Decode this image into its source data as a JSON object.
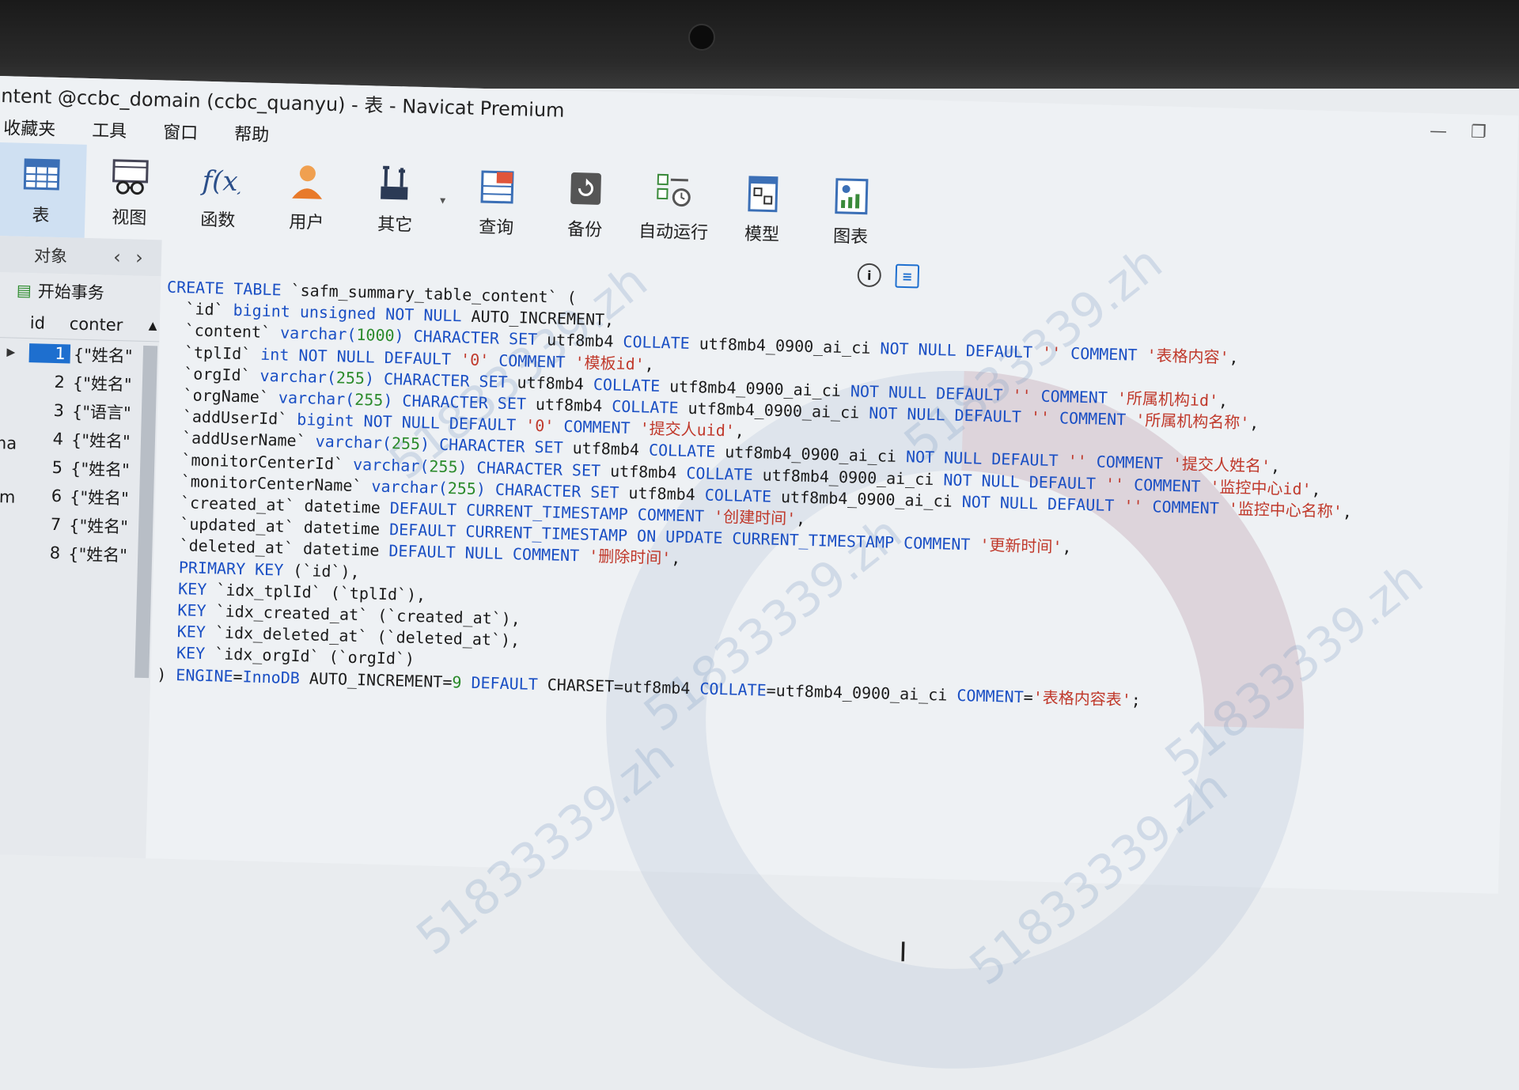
{
  "window": {
    "title": "ntent @ccbc_domain (ccbc_quanyu) - 表 - Navicat Premium"
  },
  "menu": [
    "收藏夹",
    "工具",
    "窗口",
    "帮助"
  ],
  "toolbar": [
    {
      "label": "表",
      "icon": "table-icon",
      "active": true
    },
    {
      "label": "视图",
      "icon": "view-icon"
    },
    {
      "label": "函数",
      "icon": "function-icon"
    },
    {
      "label": "用户",
      "icon": "user-icon"
    },
    {
      "label": "其它",
      "icon": "tools-icon"
    },
    {
      "label": "查询",
      "icon": "query-icon"
    },
    {
      "label": "备份",
      "icon": "backup-icon"
    },
    {
      "label": "自动运行",
      "icon": "schedule-icon"
    },
    {
      "label": "模型",
      "icon": "model-icon"
    },
    {
      "label": "图表",
      "icon": "chart-icon"
    }
  ],
  "objects": {
    "label": "对象",
    "begin_transaction": "开始事务"
  },
  "grid": {
    "columns": [
      "id",
      "conter"
    ],
    "rows": [
      {
        "id": "1",
        "value": "{\"姓名\""
      },
      {
        "id": "2",
        "value": "{\"姓名\""
      },
      {
        "id": "3",
        "value": "{\"语言\""
      },
      {
        "id": "4",
        "value": "{\"姓名\""
      },
      {
        "id": "5",
        "value": "{\"姓名\""
      },
      {
        "id": "6",
        "value": "{\"姓名\""
      },
      {
        "id": "7",
        "value": "{\"姓名\""
      },
      {
        "id": "8",
        "value": "{\"姓名\""
      }
    ],
    "side_labels": [
      "ma",
      "em"
    ]
  },
  "sql_lines": [
    [
      [
        "kw",
        "CREATE TABLE "
      ],
      [
        "t",
        "`safm_summary_table_content` ("
      ]
    ],
    [
      [
        "t",
        "  `id` "
      ],
      [
        "kw",
        "bigint unsigned NOT NULL "
      ],
      [
        "t",
        "AUTO_INCREMENT,"
      ]
    ],
    [
      [
        "t",
        "  `content` "
      ],
      [
        "kw",
        "varchar("
      ],
      [
        "num",
        "1000"
      ],
      [
        "kw",
        ") CHARACTER SET "
      ],
      [
        "t",
        "utf8mb4 "
      ],
      [
        "kw",
        "COLLATE "
      ],
      [
        "t",
        "utf8mb4_0900_ai_ci "
      ],
      [
        "kw",
        "NOT NULL DEFAULT "
      ],
      [
        "str",
        "'' "
      ],
      [
        "kw",
        "COMMENT "
      ],
      [
        "str",
        "'表格内容'"
      ],
      [
        "t",
        ","
      ]
    ],
    [
      [
        "t",
        "  `tplId` "
      ],
      [
        "kw",
        "int NOT NULL DEFAULT "
      ],
      [
        "str",
        "'0' "
      ],
      [
        "kw",
        "COMMENT "
      ],
      [
        "str",
        "'模板id'"
      ],
      [
        "t",
        ","
      ]
    ],
    [
      [
        "t",
        "  `orgId` "
      ],
      [
        "kw",
        "varchar("
      ],
      [
        "num",
        "255"
      ],
      [
        "kw",
        ") CHARACTER SET "
      ],
      [
        "t",
        "utf8mb4 "
      ],
      [
        "kw",
        "COLLATE "
      ],
      [
        "t",
        "utf8mb4_0900_ai_ci "
      ],
      [
        "kw",
        "NOT NULL DEFAULT "
      ],
      [
        "str",
        "'' "
      ],
      [
        "kw",
        "COMMENT "
      ],
      [
        "str",
        "'所属机构id'"
      ],
      [
        "t",
        ","
      ]
    ],
    [
      [
        "t",
        "  `orgName` "
      ],
      [
        "kw",
        "varchar("
      ],
      [
        "num",
        "255"
      ],
      [
        "kw",
        ") CHARACTER SET "
      ],
      [
        "t",
        "utf8mb4 "
      ],
      [
        "kw",
        "COLLATE "
      ],
      [
        "t",
        "utf8mb4_0900_ai_ci "
      ],
      [
        "kw",
        "NOT NULL DEFAULT "
      ],
      [
        "str",
        "'' "
      ],
      [
        "kw",
        "COMMENT "
      ],
      [
        "str",
        "'所属机构名称'"
      ],
      [
        "t",
        ","
      ]
    ],
    [
      [
        "t",
        "  `addUserId` "
      ],
      [
        "kw",
        "bigint NOT NULL DEFAULT "
      ],
      [
        "str",
        "'0' "
      ],
      [
        "kw",
        "COMMENT "
      ],
      [
        "str",
        "'提交人uid'"
      ],
      [
        "t",
        ","
      ]
    ],
    [
      [
        "t",
        "  `addUserName` "
      ],
      [
        "kw",
        "varchar("
      ],
      [
        "num",
        "255"
      ],
      [
        "kw",
        ") CHARACTER SET "
      ],
      [
        "t",
        "utf8mb4 "
      ],
      [
        "kw",
        "COLLATE "
      ],
      [
        "t",
        "utf8mb4_0900_ai_ci "
      ],
      [
        "kw",
        "NOT NULL DEFAULT "
      ],
      [
        "str",
        "'' "
      ],
      [
        "kw",
        "COMMENT "
      ],
      [
        "str",
        "'提交人姓名'"
      ],
      [
        "t",
        ","
      ]
    ],
    [
      [
        "t",
        "  `monitorCenterId` "
      ],
      [
        "kw",
        "varchar("
      ],
      [
        "num",
        "255"
      ],
      [
        "kw",
        ") CHARACTER SET "
      ],
      [
        "t",
        "utf8mb4 "
      ],
      [
        "kw",
        "COLLATE "
      ],
      [
        "t",
        "utf8mb4_0900_ai_ci "
      ],
      [
        "kw",
        "NOT NULL DEFAULT "
      ],
      [
        "str",
        "'' "
      ],
      [
        "kw",
        "COMMENT "
      ],
      [
        "str",
        "'监控中心id'"
      ],
      [
        "t",
        ","
      ]
    ],
    [
      [
        "t",
        "  `monitorCenterName` "
      ],
      [
        "kw",
        "varchar("
      ],
      [
        "num",
        "255"
      ],
      [
        "kw",
        ") CHARACTER SET "
      ],
      [
        "t",
        "utf8mb4 "
      ],
      [
        "kw",
        "COLLATE "
      ],
      [
        "t",
        "utf8mb4_0900_ai_ci "
      ],
      [
        "kw",
        "NOT NULL DEFAULT "
      ],
      [
        "str",
        "'' "
      ],
      [
        "kw",
        "COMMENT "
      ],
      [
        "str",
        "'监控中心名称'"
      ],
      [
        "t",
        ","
      ]
    ],
    [
      [
        "t",
        "  `created_at` datetime "
      ],
      [
        "kw",
        "DEFAULT CURRENT_TIMESTAMP COMMENT "
      ],
      [
        "str",
        "'创建时间'"
      ],
      [
        "t",
        ","
      ]
    ],
    [
      [
        "t",
        "  `updated_at` datetime "
      ],
      [
        "kw",
        "DEFAULT CURRENT_TIMESTAMP ON UPDATE CURRENT_TIMESTAMP COMMENT "
      ],
      [
        "str",
        "'更新时间'"
      ],
      [
        "t",
        ","
      ]
    ],
    [
      [
        "t",
        "  `deleted_at` datetime "
      ],
      [
        "kw",
        "DEFAULT NULL COMMENT "
      ],
      [
        "str",
        "'删除时间'"
      ],
      [
        "t",
        ","
      ]
    ],
    [
      [
        "kw",
        "  PRIMARY KEY "
      ],
      [
        "t",
        "(`id`),"
      ]
    ],
    [
      [
        "kw",
        "  KEY "
      ],
      [
        "t",
        "`idx_tplId` (`tplId`),"
      ]
    ],
    [
      [
        "kw",
        "  KEY "
      ],
      [
        "t",
        "`idx_created_at` (`created_at`),"
      ]
    ],
    [
      [
        "kw",
        "  KEY "
      ],
      [
        "t",
        "`idx_deleted_at` (`deleted_at`),"
      ]
    ],
    [
      [
        "kw",
        "  KEY "
      ],
      [
        "t",
        "`idx_orgId` (`orgId`)"
      ]
    ],
    [
      [
        "t",
        ") "
      ],
      [
        "kw",
        "ENGINE"
      ],
      [
        "t",
        "="
      ],
      [
        "kw",
        "InnoDB "
      ],
      [
        "t",
        "AUTO_INCREMENT="
      ],
      [
        "num",
        "9 "
      ],
      [
        "kw",
        "DEFAULT "
      ],
      [
        "t",
        "CHARSET=utf8mb4 "
      ],
      [
        "kw",
        "COLLATE"
      ],
      [
        "t",
        "=utf8mb4_0900_ai_ci "
      ],
      [
        "kw",
        "COMMENT"
      ],
      [
        "t",
        "="
      ],
      [
        "str",
        "'表格内容表'"
      ],
      [
        "t",
        ";"
      ]
    ]
  ],
  "watermark": "51833339.zh"
}
